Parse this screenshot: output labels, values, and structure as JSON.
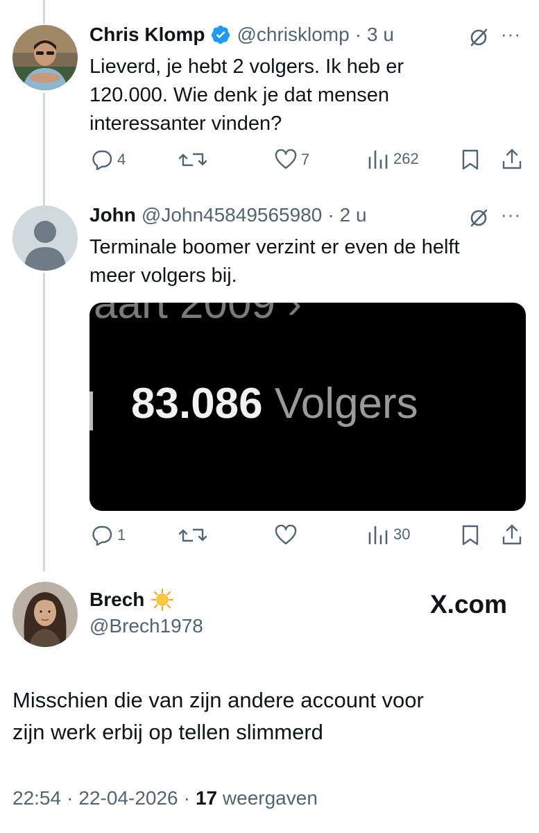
{
  "tweets": [
    {
      "name": "Chris Klomp",
      "handle": "@chrisklomp",
      "sep": "·",
      "time": "3 u",
      "text_lines": [
        "Lieverd, je hebt 2 volgers. Ik heb er",
        "120.000. Wie denk je dat mensen",
        "interessanter vinden?"
      ],
      "replies": "4",
      "likes": "7",
      "views": "262",
      "verified_icon": "verified-badge-icon"
    },
    {
      "name": "John",
      "handle": "@John45849565980",
      "sep": "·",
      "time": "2 u",
      "text_lines": [
        "Terminale boomer verzint er even de helft",
        "meer volgers bij."
      ],
      "media": {
        "top_partial": "aart 2009 ›",
        "count": "83.086",
        "label": "Volgers"
      },
      "replies": "1",
      "likes": "",
      "views": "30"
    }
  ],
  "main_post": {
    "name": "Brech",
    "emoji": "☀️",
    "handle": "@Brech1978",
    "brand": "X.com",
    "text_lines": [
      "Misschien die van zijn andere account voor",
      "zijn werk erbij op tellen slimmerd"
    ],
    "time": "22:54",
    "date": "22-04-2026",
    "sep": "·",
    "views_count": "17",
    "views_label": "weergaven"
  },
  "colors": {
    "text": "#0f1419",
    "muted": "#536471",
    "verified": "#1d9bf0",
    "thread_line": "#cfd9de",
    "media_bg": "#000000"
  }
}
